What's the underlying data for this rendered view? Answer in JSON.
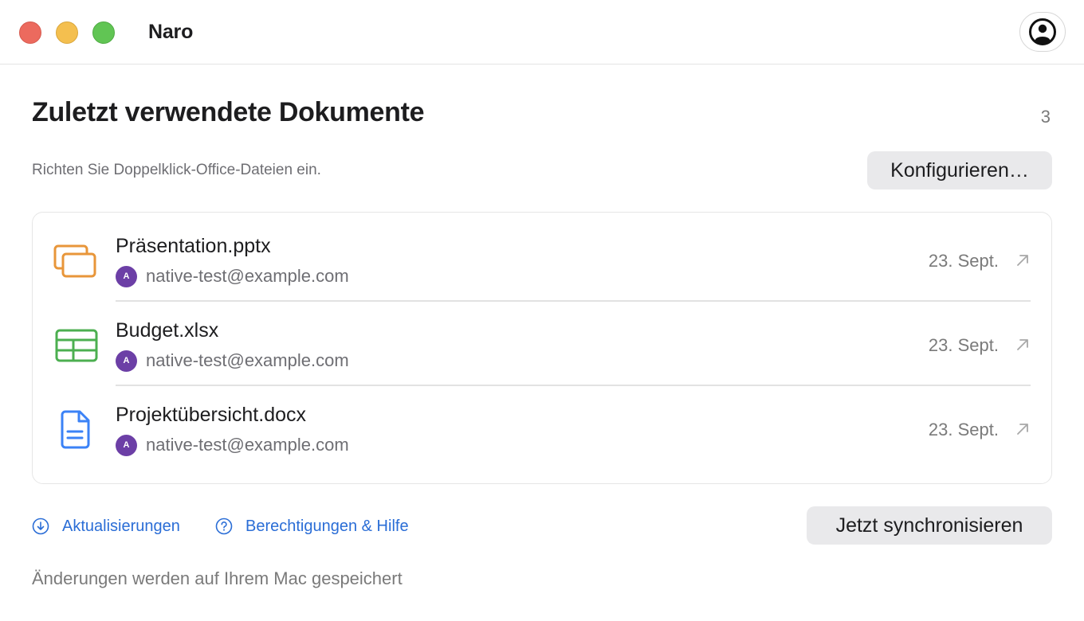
{
  "window": {
    "app_title": "Naro",
    "controls": [
      "close",
      "minimize",
      "zoom"
    ],
    "profile_icon": "person-circle-icon"
  },
  "header": {
    "title": "Zuletzt verwendete Dokumente",
    "count": "3",
    "subtitle": "Richten Sie Doppelklick-Office-Dateien ein.",
    "configure_label": "Konfigurieren…"
  },
  "documents": [
    {
      "name": "Präsentation.pptx",
      "owner_initial": "A",
      "owner": "native-test@example.com",
      "date": "23. Sept.",
      "icon": "presentation-icon",
      "color": "#e8963a"
    },
    {
      "name": "Budget.xlsx",
      "owner_initial": "A",
      "owner": "native-test@example.com",
      "date": "23. Sept.",
      "icon": "spreadsheet-icon",
      "color": "#4caf50"
    },
    {
      "name": "Projektübersicht.docx",
      "owner_initial": "A",
      "owner": "native-test@example.com",
      "date": "23. Sept.",
      "icon": "document-icon",
      "color": "#3b82f6"
    }
  ],
  "footer": {
    "updates_label": "Aktualisierungen",
    "help_label": "Berechtigungen & Hilfe",
    "sync_label": "Jetzt synchronisieren",
    "note": "Änderungen werden auf Ihrem Mac gespeichert"
  },
  "colors": {
    "accent_link": "#2a6dd6",
    "avatar": "#6c3fa6"
  }
}
